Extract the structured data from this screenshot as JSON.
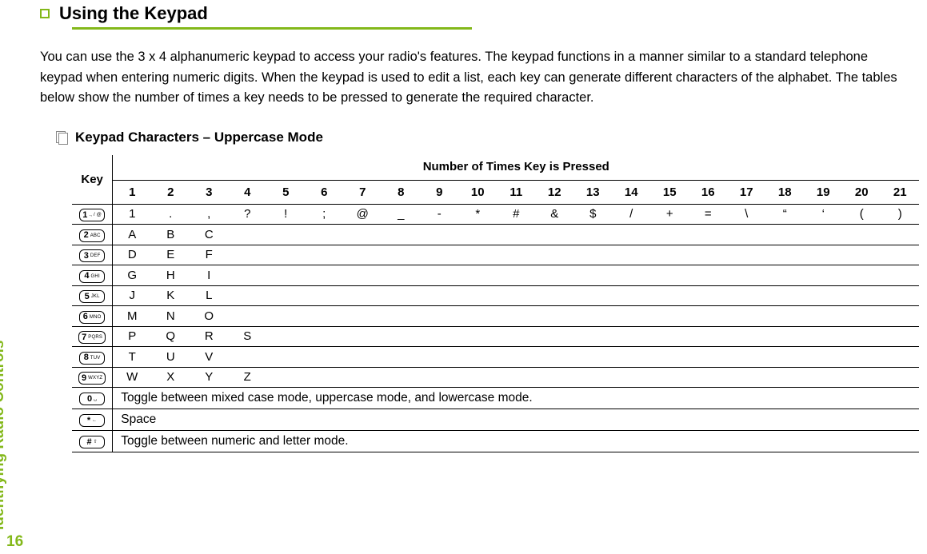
{
  "side": {
    "label": "Identifying Radio Controls",
    "page": "16"
  },
  "title": "Using the Keypad",
  "body": "You can use the 3 x 4 alphanumeric keypad to access your radio's features. The keypad functions in a manner similar to a standard telephone keypad when entering numeric digits. When the keypad is used to edit a list, each key can generate different characters of the alphabet. The tables below show the number of times a key needs to be pressed to generate the required character.",
  "sub_title": "Keypad Characters – Uppercase Mode",
  "table": {
    "super_header": "Number of Times Key is Pressed",
    "key_header": "Key",
    "cols": [
      "1",
      "2",
      "3",
      "4",
      "5",
      "6",
      "7",
      "8",
      "9",
      "10",
      "11",
      "12",
      "13",
      "14",
      "15",
      "16",
      "17",
      "18",
      "19",
      "20",
      "21"
    ],
    "rows": [
      {
        "key_big": "1",
        "key_small": "., / @",
        "cells": [
          "1",
          ".",
          ",",
          "?",
          "!",
          ";",
          "@",
          "_",
          "-",
          "*",
          "#",
          "&",
          "$",
          "/",
          "+",
          "=",
          "\\",
          "“",
          "‘",
          "(",
          ")"
        ]
      },
      {
        "key_big": "2",
        "key_small": "ABC",
        "cells": [
          "A",
          "B",
          "C",
          "",
          "",
          "",
          "",
          "",
          "",
          "",
          "",
          "",
          "",
          "",
          "",
          "",
          "",
          "",
          "",
          "",
          ""
        ]
      },
      {
        "key_big": "3",
        "key_small": "DEF",
        "cells": [
          "D",
          "E",
          "F",
          "",
          "",
          "",
          "",
          "",
          "",
          "",
          "",
          "",
          "",
          "",
          "",
          "",
          "",
          "",
          "",
          "",
          ""
        ]
      },
      {
        "key_big": "4",
        "key_small": "GHI",
        "cells": [
          "G",
          "H",
          "I",
          "",
          "",
          "",
          "",
          "",
          "",
          "",
          "",
          "",
          "",
          "",
          "",
          "",
          "",
          "",
          "",
          "",
          ""
        ]
      },
      {
        "key_big": "5",
        "key_small": "JKL",
        "cells": [
          "J",
          "K",
          "L",
          "",
          "",
          "",
          "",
          "",
          "",
          "",
          "",
          "",
          "",
          "",
          "",
          "",
          "",
          "",
          "",
          "",
          ""
        ]
      },
      {
        "key_big": "6",
        "key_small": "MNO",
        "cells": [
          "M",
          "N",
          "O",
          "",
          "",
          "",
          "",
          "",
          "",
          "",
          "",
          "",
          "",
          "",
          "",
          "",
          "",
          "",
          "",
          "",
          ""
        ]
      },
      {
        "key_big": "7",
        "key_small": "PQRS",
        "cells": [
          "P",
          "Q",
          "R",
          "S",
          "",
          "",
          "",
          "",
          "",
          "",
          "",
          "",
          "",
          "",
          "",
          "",
          "",
          "",
          "",
          "",
          ""
        ]
      },
      {
        "key_big": "8",
        "key_small": "TUV",
        "cells": [
          "T",
          "U",
          "V",
          "",
          "",
          "",
          "",
          "",
          "",
          "",
          "",
          "",
          "",
          "",
          "",
          "",
          "",
          "",
          "",
          "",
          ""
        ]
      },
      {
        "key_big": "9",
        "key_small": "WXYZ",
        "cells": [
          "W",
          "X",
          "Y",
          "Z",
          "",
          "",
          "",
          "",
          "",
          "",
          "",
          "",
          "",
          "",
          "",
          "",
          "",
          "",
          "",
          "",
          ""
        ]
      },
      {
        "key_big": "0",
        "key_small": "␣",
        "long": "Toggle between mixed case mode, uppercase mode, and lowercase mode."
      },
      {
        "key_big": "*",
        "key_small": "←",
        "long": "Space"
      },
      {
        "key_big": "#",
        "key_small": "⇧",
        "long": "Toggle between numeric and letter mode."
      }
    ]
  }
}
